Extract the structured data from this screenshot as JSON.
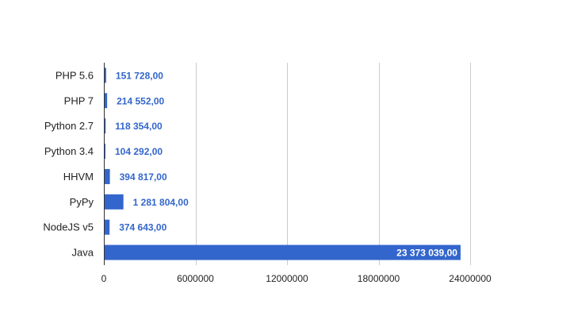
{
  "chart_data": {
    "type": "bar",
    "orientation": "horizontal",
    "categories": [
      "PHP 5.6",
      "PHP 7",
      "Python 2.7",
      "Python 3.4",
      "HHVM",
      "PyPy",
      "NodeJS v5",
      "Java"
    ],
    "values": [
      151728,
      214552,
      118354,
      104292,
      394817,
      1281804,
      374643,
      23373039
    ],
    "data_labels": [
      "151 728,00",
      "214 552,00",
      "118 354,00",
      "104 292,00",
      "394 817,00",
      "1 281 804,00",
      "374 643,00",
      "23 373 039,00"
    ],
    "x_ticks": [
      0,
      6000000,
      12000000,
      18000000,
      24000000
    ],
    "x_tick_labels": [
      "0",
      "6000000",
      "12000000",
      "18000000",
      "24000000"
    ],
    "xlim": [
      0,
      24000000
    ],
    "title": "",
    "xlabel": "",
    "ylabel": "",
    "grid": true,
    "legend": "none",
    "colors": {
      "bar": "#3366cc",
      "label": "#3366cc",
      "label_inside": "#ffffff",
      "grid": "#cccccc",
      "text": "#222222",
      "axis": "#333333"
    }
  }
}
